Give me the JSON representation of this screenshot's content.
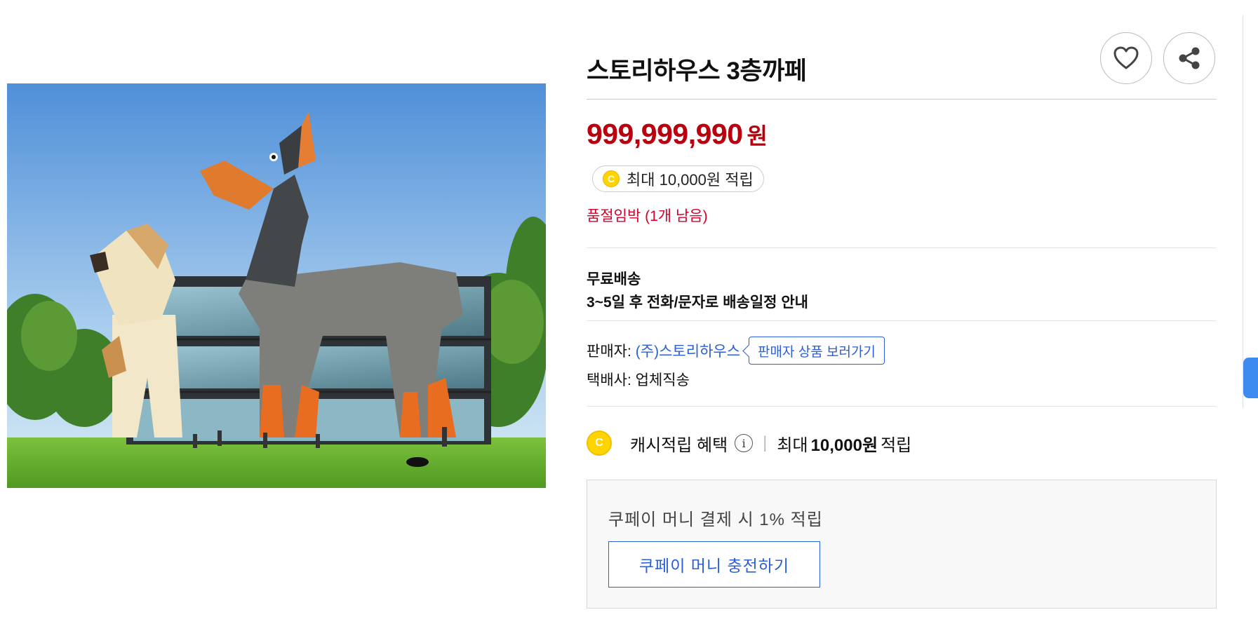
{
  "product": {
    "title": "스토리하우스 3층까페",
    "price": "999,999,990",
    "price_unit": "원",
    "cash_pill": "최대 10,000원 적립",
    "stock_notice": "품절임박 (1개 남음)"
  },
  "shipping": {
    "line1": "무료배송",
    "line2": "3~5일 후 전화/문자로 배송일정 안내"
  },
  "seller": {
    "label": "판매자:",
    "name": "(주)스토리하우스",
    "view_products": "판매자 상품 보러가기",
    "courier_label": "택배사:",
    "courier": "업체직송"
  },
  "cash_benefit": {
    "coin_letter": "C",
    "label": "캐시적립 혜택",
    "info": "i",
    "prefix": "최대",
    "amount": "10,000원",
    "suffix": "적립"
  },
  "kpay": {
    "text": "쿠페이 머니 결제 시 1% 적립",
    "button": "쿠페이 머니 충전하기"
  },
  "icons": {
    "wish": "heart-icon",
    "share": "share-icon"
  },
  "colors": {
    "price": "#b8000f",
    "link": "#2c5ed6",
    "stock": "#d6002a",
    "coin": "#ffd400"
  }
}
